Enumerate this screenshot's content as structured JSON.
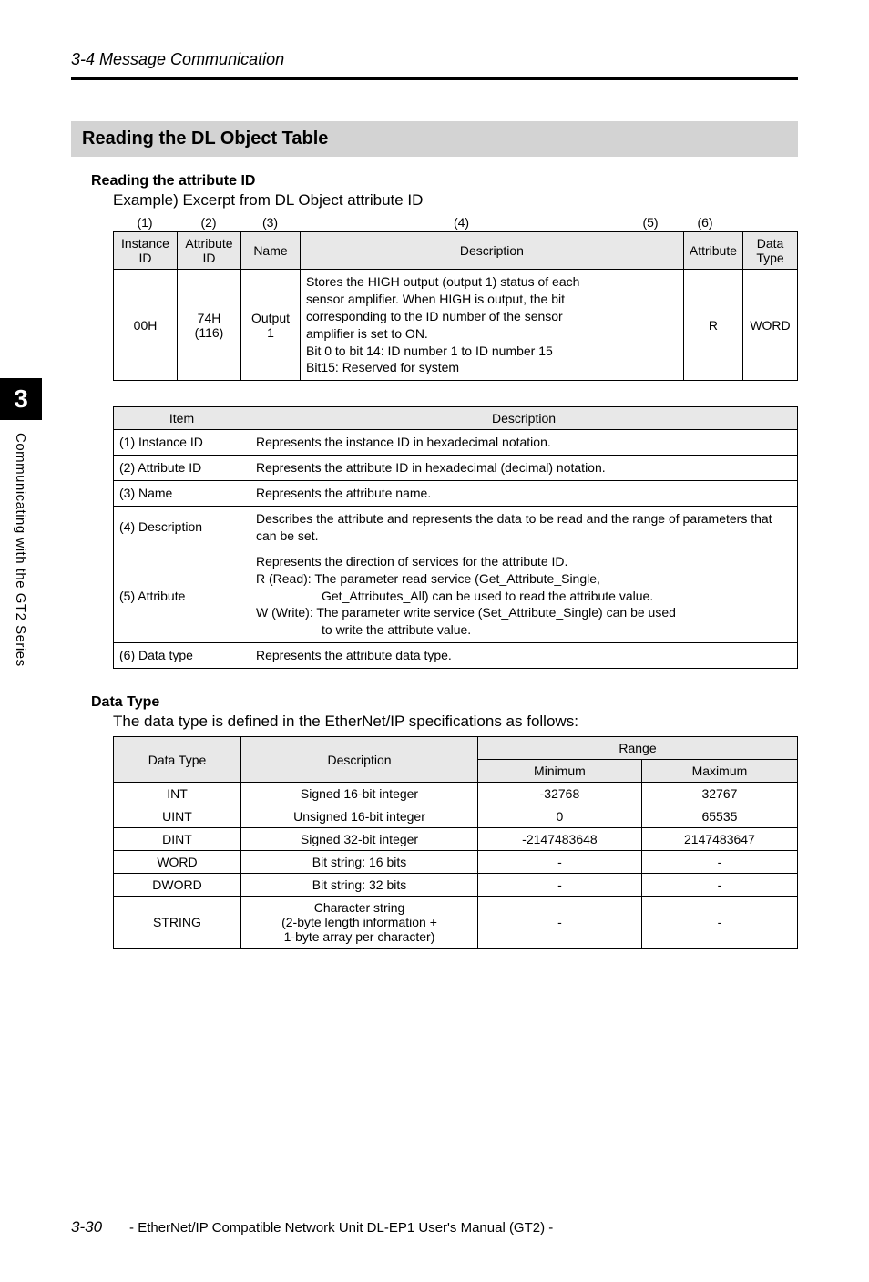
{
  "header": {
    "section": "3-4 Message Communication"
  },
  "sidebar": {
    "chapter": "3",
    "title": "Communicating with the GT2 Series"
  },
  "heading_main": "Reading the DL Object Table",
  "attr_id": {
    "heading": "Reading the attribute ID",
    "example": "Example) Excerpt from DL Object attribute ID",
    "col_nums": [
      "(1)",
      "(2)",
      "(3)",
      "(4)",
      "(5)",
      "(6)"
    ],
    "headers": [
      "Instance ID",
      "Attribute ID",
      "Name",
      "Description",
      "Attribute",
      "Data Type"
    ],
    "row": {
      "instance": "00H",
      "attr_id": "74H (116)",
      "name": "Output 1",
      "desc_l1": "Stores the HIGH output (output 1) status of each",
      "desc_l2": "sensor amplifier. When HIGH is output, the bit",
      "desc_l3": "corresponding to the ID number of the sensor",
      "desc_l4": "amplifier is set to ON.",
      "desc_l5": "Bit 0 to bit 14: ID number 1 to ID number 15",
      "desc_l6": "Bit15: Reserved for system",
      "attribute": "R",
      "dtype": "WORD"
    }
  },
  "item_table": {
    "headers": [
      "Item",
      "Description"
    ],
    "rows": [
      {
        "item": "(1) Instance ID",
        "desc": "Represents the instance ID in hexadecimal notation."
      },
      {
        "item": "(2) Attribute ID",
        "desc": "Represents the attribute ID in hexadecimal (decimal) notation."
      },
      {
        "item": "(3) Name",
        "desc": "Represents the attribute name."
      },
      {
        "item": "(4) Description",
        "desc": "Describes the attribute and represents the data to be read and the range of parameters that can be set."
      },
      {
        "item": "(5) Attribute",
        "desc_l1": "Represents the direction of services for the attribute ID.",
        "desc_l2": "R (Read): The parameter read service (Get_Attribute_Single,",
        "desc_l3": "Get_Attributes_All) can be used to read the attribute value.",
        "desc_l4": "W (Write): The parameter write service (Set_Attribute_Single) can be used",
        "desc_l5": "to write the attribute value."
      },
      {
        "item": "(6) Data type",
        "desc": "Represents the attribute data type."
      }
    ]
  },
  "data_type": {
    "heading": "Data Type",
    "body": "The data type is defined in the EtherNet/IP specifications as follows:",
    "headers": {
      "dt": "Data Type",
      "desc": "Description",
      "range": "Range",
      "min": "Minimum",
      "max": "Maximum"
    },
    "rows": [
      {
        "dt": "INT",
        "desc": "Signed 16-bit integer",
        "min": "-32768",
        "max": "32767"
      },
      {
        "dt": "UINT",
        "desc": "Unsigned 16-bit integer",
        "min": "0",
        "max": "65535"
      },
      {
        "dt": "DINT",
        "desc": "Signed 32-bit integer",
        "min": "-2147483648",
        "max": "2147483647"
      },
      {
        "dt": "WORD",
        "desc": "Bit string: 16 bits",
        "min": "-",
        "max": "-"
      },
      {
        "dt": "DWORD",
        "desc": "Bit string: 32 bits",
        "min": "-",
        "max": "-"
      },
      {
        "dt": "STRING",
        "desc_l1": "Character string",
        "desc_l2": "(2-byte length information +",
        "desc_l3": "1-byte array per character)",
        "min": "-",
        "max": "-"
      }
    ]
  },
  "footer": {
    "page": "3-30",
    "manual": "- EtherNet/IP Compatible Network Unit DL-EP1 User's Manual (GT2) -"
  }
}
